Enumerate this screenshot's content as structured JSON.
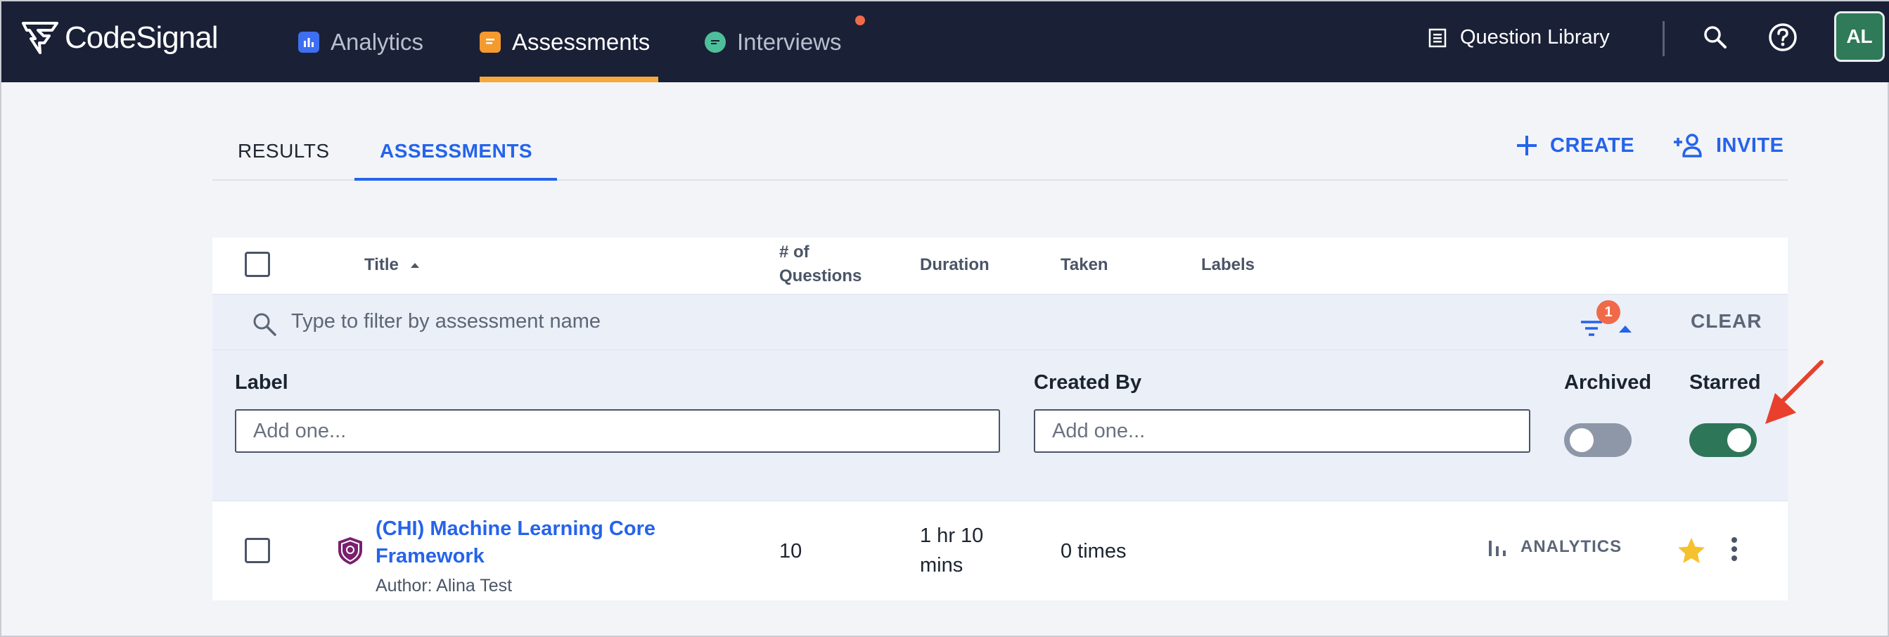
{
  "app": {
    "logo_text": "CodeSignal"
  },
  "nav": {
    "items": [
      {
        "label": "Analytics",
        "icon": "bar-chart-icon"
      },
      {
        "label": "Assessments",
        "icon": "document-icon",
        "active": true
      },
      {
        "label": "Interviews",
        "icon": "chat-icon",
        "notification": true
      }
    ],
    "question_library": "Question Library",
    "avatar": "AL"
  },
  "subtabs": [
    {
      "label": "RESULTS"
    },
    {
      "label": "ASSESSMENTS",
      "active": true
    }
  ],
  "actions": {
    "create": "CREATE",
    "invite": "INVITE"
  },
  "table": {
    "headers": {
      "title": "Title",
      "questions_line1": "# of",
      "questions_line2": "Questions",
      "duration": "Duration",
      "taken": "Taken",
      "labels": "Labels"
    },
    "filter": {
      "placeholder": "Type to filter by assessment name",
      "badge_count": "1",
      "clear": "CLEAR"
    },
    "filter_panel": {
      "label_title": "Label",
      "label_placeholder": "Add one...",
      "created_by_title": "Created By",
      "created_by_placeholder": "Add one...",
      "archived_title": "Archived",
      "archived_on": false,
      "starred_title": "Starred",
      "starred_on": true
    },
    "rows": [
      {
        "title": "(CHI) Machine Learning Core Framework",
        "author": "Author: Alina Test",
        "questions": "10",
        "duration_line1": "1 hr 10",
        "duration_line2": "mins",
        "taken": "0 times",
        "analytics": "ANALYTICS",
        "starred": true
      }
    ]
  },
  "colors": {
    "topbar": "#1a2036",
    "accent": "#2563eb",
    "active_underline": "#f4a93b",
    "toggle_on": "#2e7658",
    "notification": "#f06a4a",
    "star": "#f5c12e",
    "annotation_arrow": "#e8402c"
  }
}
